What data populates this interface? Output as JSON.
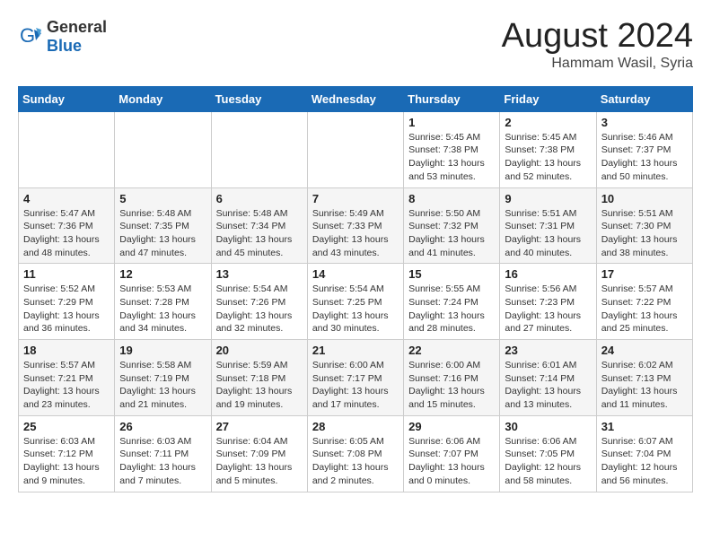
{
  "header": {
    "logo_general": "General",
    "logo_blue": "Blue",
    "main_title": "August 2024",
    "sub_title": "Hammam Wasil, Syria"
  },
  "calendar": {
    "days_of_week": [
      "Sunday",
      "Monday",
      "Tuesday",
      "Wednesday",
      "Thursday",
      "Friday",
      "Saturday"
    ],
    "weeks": [
      [
        {
          "day": "",
          "info": ""
        },
        {
          "day": "",
          "info": ""
        },
        {
          "day": "",
          "info": ""
        },
        {
          "day": "",
          "info": ""
        },
        {
          "day": "1",
          "info": "Sunrise: 5:45 AM\nSunset: 7:38 PM\nDaylight: 13 hours\nand 53 minutes."
        },
        {
          "day": "2",
          "info": "Sunrise: 5:45 AM\nSunset: 7:38 PM\nDaylight: 13 hours\nand 52 minutes."
        },
        {
          "day": "3",
          "info": "Sunrise: 5:46 AM\nSunset: 7:37 PM\nDaylight: 13 hours\nand 50 minutes."
        }
      ],
      [
        {
          "day": "4",
          "info": "Sunrise: 5:47 AM\nSunset: 7:36 PM\nDaylight: 13 hours\nand 48 minutes."
        },
        {
          "day": "5",
          "info": "Sunrise: 5:48 AM\nSunset: 7:35 PM\nDaylight: 13 hours\nand 47 minutes."
        },
        {
          "day": "6",
          "info": "Sunrise: 5:48 AM\nSunset: 7:34 PM\nDaylight: 13 hours\nand 45 minutes."
        },
        {
          "day": "7",
          "info": "Sunrise: 5:49 AM\nSunset: 7:33 PM\nDaylight: 13 hours\nand 43 minutes."
        },
        {
          "day": "8",
          "info": "Sunrise: 5:50 AM\nSunset: 7:32 PM\nDaylight: 13 hours\nand 41 minutes."
        },
        {
          "day": "9",
          "info": "Sunrise: 5:51 AM\nSunset: 7:31 PM\nDaylight: 13 hours\nand 40 minutes."
        },
        {
          "day": "10",
          "info": "Sunrise: 5:51 AM\nSunset: 7:30 PM\nDaylight: 13 hours\nand 38 minutes."
        }
      ],
      [
        {
          "day": "11",
          "info": "Sunrise: 5:52 AM\nSunset: 7:29 PM\nDaylight: 13 hours\nand 36 minutes."
        },
        {
          "day": "12",
          "info": "Sunrise: 5:53 AM\nSunset: 7:28 PM\nDaylight: 13 hours\nand 34 minutes."
        },
        {
          "day": "13",
          "info": "Sunrise: 5:54 AM\nSunset: 7:26 PM\nDaylight: 13 hours\nand 32 minutes."
        },
        {
          "day": "14",
          "info": "Sunrise: 5:54 AM\nSunset: 7:25 PM\nDaylight: 13 hours\nand 30 minutes."
        },
        {
          "day": "15",
          "info": "Sunrise: 5:55 AM\nSunset: 7:24 PM\nDaylight: 13 hours\nand 28 minutes."
        },
        {
          "day": "16",
          "info": "Sunrise: 5:56 AM\nSunset: 7:23 PM\nDaylight: 13 hours\nand 27 minutes."
        },
        {
          "day": "17",
          "info": "Sunrise: 5:57 AM\nSunset: 7:22 PM\nDaylight: 13 hours\nand 25 minutes."
        }
      ],
      [
        {
          "day": "18",
          "info": "Sunrise: 5:57 AM\nSunset: 7:21 PM\nDaylight: 13 hours\nand 23 minutes."
        },
        {
          "day": "19",
          "info": "Sunrise: 5:58 AM\nSunset: 7:19 PM\nDaylight: 13 hours\nand 21 minutes."
        },
        {
          "day": "20",
          "info": "Sunrise: 5:59 AM\nSunset: 7:18 PM\nDaylight: 13 hours\nand 19 minutes."
        },
        {
          "day": "21",
          "info": "Sunrise: 6:00 AM\nSunset: 7:17 PM\nDaylight: 13 hours\nand 17 minutes."
        },
        {
          "day": "22",
          "info": "Sunrise: 6:00 AM\nSunset: 7:16 PM\nDaylight: 13 hours\nand 15 minutes."
        },
        {
          "day": "23",
          "info": "Sunrise: 6:01 AM\nSunset: 7:14 PM\nDaylight: 13 hours\nand 13 minutes."
        },
        {
          "day": "24",
          "info": "Sunrise: 6:02 AM\nSunset: 7:13 PM\nDaylight: 13 hours\nand 11 minutes."
        }
      ],
      [
        {
          "day": "25",
          "info": "Sunrise: 6:03 AM\nSunset: 7:12 PM\nDaylight: 13 hours\nand 9 minutes."
        },
        {
          "day": "26",
          "info": "Sunrise: 6:03 AM\nSunset: 7:11 PM\nDaylight: 13 hours\nand 7 minutes."
        },
        {
          "day": "27",
          "info": "Sunrise: 6:04 AM\nSunset: 7:09 PM\nDaylight: 13 hours\nand 5 minutes."
        },
        {
          "day": "28",
          "info": "Sunrise: 6:05 AM\nSunset: 7:08 PM\nDaylight: 13 hours\nand 2 minutes."
        },
        {
          "day": "29",
          "info": "Sunrise: 6:06 AM\nSunset: 7:07 PM\nDaylight: 13 hours\nand 0 minutes."
        },
        {
          "day": "30",
          "info": "Sunrise: 6:06 AM\nSunset: 7:05 PM\nDaylight: 12 hours\nand 58 minutes."
        },
        {
          "day": "31",
          "info": "Sunrise: 6:07 AM\nSunset: 7:04 PM\nDaylight: 12 hours\nand 56 minutes."
        }
      ]
    ]
  }
}
